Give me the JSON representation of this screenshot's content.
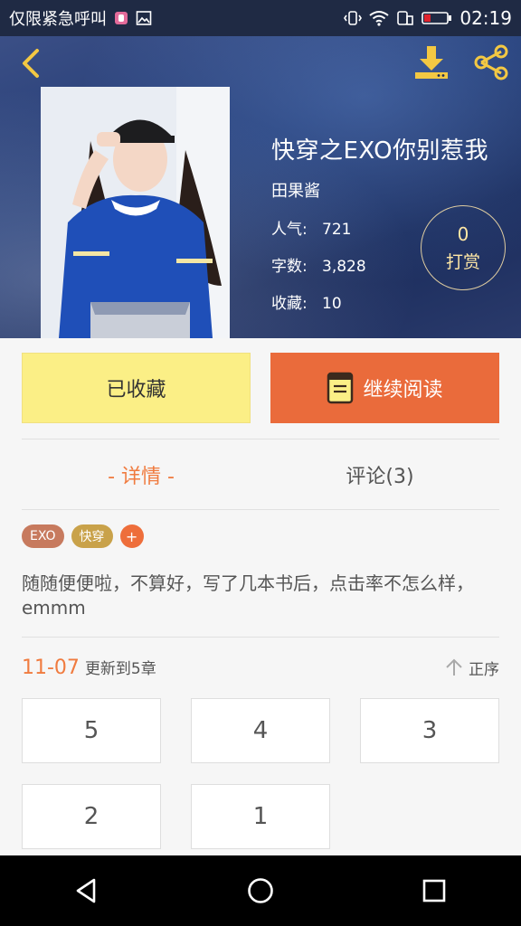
{
  "status_bar": {
    "carrier": "仅限紧急呼叫",
    "time": "02:19"
  },
  "hero": {
    "title": "快穿之EXO你别惹我",
    "author": "田果酱",
    "stats": [
      {
        "label": "人气:",
        "value": "721"
      },
      {
        "label": "字数:",
        "value": "3,828"
      },
      {
        "label": "收藏:",
        "value": "10"
      }
    ],
    "reward": {
      "count": "0",
      "label": "打赏"
    }
  },
  "actions": {
    "collect_label": "已收藏",
    "read_label": "继续阅读"
  },
  "tabs": {
    "details": "- 详情 -",
    "comments": "评论(3)"
  },
  "tags": [
    {
      "label": "EXO"
    },
    {
      "label": "快穿"
    },
    {
      "label": "+"
    }
  ],
  "description": "随随便便啦，不算好，写了几本书后，点击率不怎么样，emmm",
  "update": {
    "date": "11-07",
    "text": "更新到5章",
    "sort_label": "正序"
  },
  "chapters": [
    {
      "label": "5"
    },
    {
      "label": "4"
    },
    {
      "label": "3"
    },
    {
      "label": "2"
    },
    {
      "label": "1"
    }
  ],
  "colors": {
    "accent_orange": "#ea6b3b",
    "accent_text_orange": "#f07b3f",
    "collect_yellow": "#fbef86",
    "reward_gold": "#ffe7a5"
  },
  "icons": {
    "back": "chevron-left-icon",
    "download": "download-icon",
    "share": "share-icon",
    "read": "book-icon",
    "sort": "arrow-up-icon"
  }
}
